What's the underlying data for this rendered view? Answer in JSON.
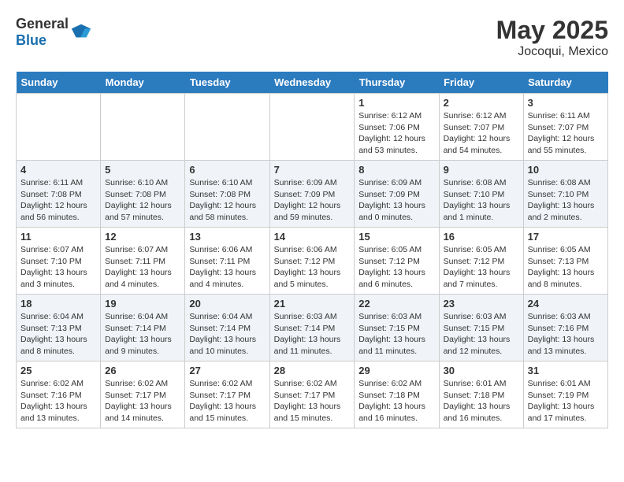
{
  "header": {
    "logo_general": "General",
    "logo_blue": "Blue",
    "title": "May 2025",
    "subtitle": "Jocoqui, Mexico"
  },
  "days_of_week": [
    "Sunday",
    "Monday",
    "Tuesday",
    "Wednesday",
    "Thursday",
    "Friday",
    "Saturday"
  ],
  "weeks": [
    [
      {
        "day": "",
        "sunrise": "",
        "sunset": "",
        "daylight": ""
      },
      {
        "day": "",
        "sunrise": "",
        "sunset": "",
        "daylight": ""
      },
      {
        "day": "",
        "sunrise": "",
        "sunset": "",
        "daylight": ""
      },
      {
        "day": "",
        "sunrise": "",
        "sunset": "",
        "daylight": ""
      },
      {
        "day": "1",
        "sunrise": "Sunrise: 6:12 AM",
        "sunset": "Sunset: 7:06 PM",
        "daylight": "Daylight: 12 hours and 53 minutes."
      },
      {
        "day": "2",
        "sunrise": "Sunrise: 6:12 AM",
        "sunset": "Sunset: 7:07 PM",
        "daylight": "Daylight: 12 hours and 54 minutes."
      },
      {
        "day": "3",
        "sunrise": "Sunrise: 6:11 AM",
        "sunset": "Sunset: 7:07 PM",
        "daylight": "Daylight: 12 hours and 55 minutes."
      }
    ],
    [
      {
        "day": "4",
        "sunrise": "Sunrise: 6:11 AM",
        "sunset": "Sunset: 7:08 PM",
        "daylight": "Daylight: 12 hours and 56 minutes."
      },
      {
        "day": "5",
        "sunrise": "Sunrise: 6:10 AM",
        "sunset": "Sunset: 7:08 PM",
        "daylight": "Daylight: 12 hours and 57 minutes."
      },
      {
        "day": "6",
        "sunrise": "Sunrise: 6:10 AM",
        "sunset": "Sunset: 7:08 PM",
        "daylight": "Daylight: 12 hours and 58 minutes."
      },
      {
        "day": "7",
        "sunrise": "Sunrise: 6:09 AM",
        "sunset": "Sunset: 7:09 PM",
        "daylight": "Daylight: 12 hours and 59 minutes."
      },
      {
        "day": "8",
        "sunrise": "Sunrise: 6:09 AM",
        "sunset": "Sunset: 7:09 PM",
        "daylight": "Daylight: 13 hours and 0 minutes."
      },
      {
        "day": "9",
        "sunrise": "Sunrise: 6:08 AM",
        "sunset": "Sunset: 7:10 PM",
        "daylight": "Daylight: 13 hours and 1 minute."
      },
      {
        "day": "10",
        "sunrise": "Sunrise: 6:08 AM",
        "sunset": "Sunset: 7:10 PM",
        "daylight": "Daylight: 13 hours and 2 minutes."
      }
    ],
    [
      {
        "day": "11",
        "sunrise": "Sunrise: 6:07 AM",
        "sunset": "Sunset: 7:10 PM",
        "daylight": "Daylight: 13 hours and 3 minutes."
      },
      {
        "day": "12",
        "sunrise": "Sunrise: 6:07 AM",
        "sunset": "Sunset: 7:11 PM",
        "daylight": "Daylight: 13 hours and 4 minutes."
      },
      {
        "day": "13",
        "sunrise": "Sunrise: 6:06 AM",
        "sunset": "Sunset: 7:11 PM",
        "daylight": "Daylight: 13 hours and 4 minutes."
      },
      {
        "day": "14",
        "sunrise": "Sunrise: 6:06 AM",
        "sunset": "Sunset: 7:12 PM",
        "daylight": "Daylight: 13 hours and 5 minutes."
      },
      {
        "day": "15",
        "sunrise": "Sunrise: 6:05 AM",
        "sunset": "Sunset: 7:12 PM",
        "daylight": "Daylight: 13 hours and 6 minutes."
      },
      {
        "day": "16",
        "sunrise": "Sunrise: 6:05 AM",
        "sunset": "Sunset: 7:12 PM",
        "daylight": "Daylight: 13 hours and 7 minutes."
      },
      {
        "day": "17",
        "sunrise": "Sunrise: 6:05 AM",
        "sunset": "Sunset: 7:13 PM",
        "daylight": "Daylight: 13 hours and 8 minutes."
      }
    ],
    [
      {
        "day": "18",
        "sunrise": "Sunrise: 6:04 AM",
        "sunset": "Sunset: 7:13 PM",
        "daylight": "Daylight: 13 hours and 8 minutes."
      },
      {
        "day": "19",
        "sunrise": "Sunrise: 6:04 AM",
        "sunset": "Sunset: 7:14 PM",
        "daylight": "Daylight: 13 hours and 9 minutes."
      },
      {
        "day": "20",
        "sunrise": "Sunrise: 6:04 AM",
        "sunset": "Sunset: 7:14 PM",
        "daylight": "Daylight: 13 hours and 10 minutes."
      },
      {
        "day": "21",
        "sunrise": "Sunrise: 6:03 AM",
        "sunset": "Sunset: 7:14 PM",
        "daylight": "Daylight: 13 hours and 11 minutes."
      },
      {
        "day": "22",
        "sunrise": "Sunrise: 6:03 AM",
        "sunset": "Sunset: 7:15 PM",
        "daylight": "Daylight: 13 hours and 11 minutes."
      },
      {
        "day": "23",
        "sunrise": "Sunrise: 6:03 AM",
        "sunset": "Sunset: 7:15 PM",
        "daylight": "Daylight: 13 hours and 12 minutes."
      },
      {
        "day": "24",
        "sunrise": "Sunrise: 6:03 AM",
        "sunset": "Sunset: 7:16 PM",
        "daylight": "Daylight: 13 hours and 13 minutes."
      }
    ],
    [
      {
        "day": "25",
        "sunrise": "Sunrise: 6:02 AM",
        "sunset": "Sunset: 7:16 PM",
        "daylight": "Daylight: 13 hours and 13 minutes."
      },
      {
        "day": "26",
        "sunrise": "Sunrise: 6:02 AM",
        "sunset": "Sunset: 7:17 PM",
        "daylight": "Daylight: 13 hours and 14 minutes."
      },
      {
        "day": "27",
        "sunrise": "Sunrise: 6:02 AM",
        "sunset": "Sunset: 7:17 PM",
        "daylight": "Daylight: 13 hours and 15 minutes."
      },
      {
        "day": "28",
        "sunrise": "Sunrise: 6:02 AM",
        "sunset": "Sunset: 7:17 PM",
        "daylight": "Daylight: 13 hours and 15 minutes."
      },
      {
        "day": "29",
        "sunrise": "Sunrise: 6:02 AM",
        "sunset": "Sunset: 7:18 PM",
        "daylight": "Daylight: 13 hours and 16 minutes."
      },
      {
        "day": "30",
        "sunrise": "Sunrise: 6:01 AM",
        "sunset": "Sunset: 7:18 PM",
        "daylight": "Daylight: 13 hours and 16 minutes."
      },
      {
        "day": "31",
        "sunrise": "Sunrise: 6:01 AM",
        "sunset": "Sunset: 7:19 PM",
        "daylight": "Daylight: 13 hours and 17 minutes."
      }
    ]
  ]
}
